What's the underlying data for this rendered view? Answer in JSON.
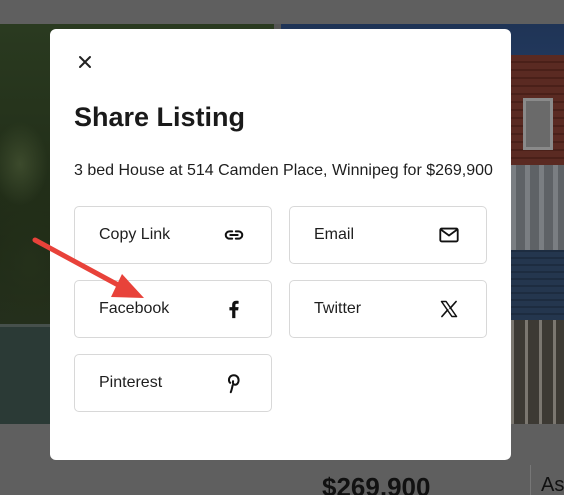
{
  "background": {
    "price": "$269,900",
    "side_text": "As"
  },
  "modal": {
    "title": "Share Listing",
    "description": "3 bed House at 514 Camden Place, Winnipeg for $269,900",
    "close_icon": "close-icon",
    "buttons": [
      {
        "label": "Copy Link",
        "icon": "link-icon"
      },
      {
        "label": "Email",
        "icon": "email-icon"
      },
      {
        "label": "Facebook",
        "icon": "facebook-icon"
      },
      {
        "label": "Twitter",
        "icon": "x-twitter-icon"
      },
      {
        "label": "Pinterest",
        "icon": "pinterest-icon"
      }
    ]
  },
  "annotation": {
    "arrow_color": "#e8423a"
  }
}
